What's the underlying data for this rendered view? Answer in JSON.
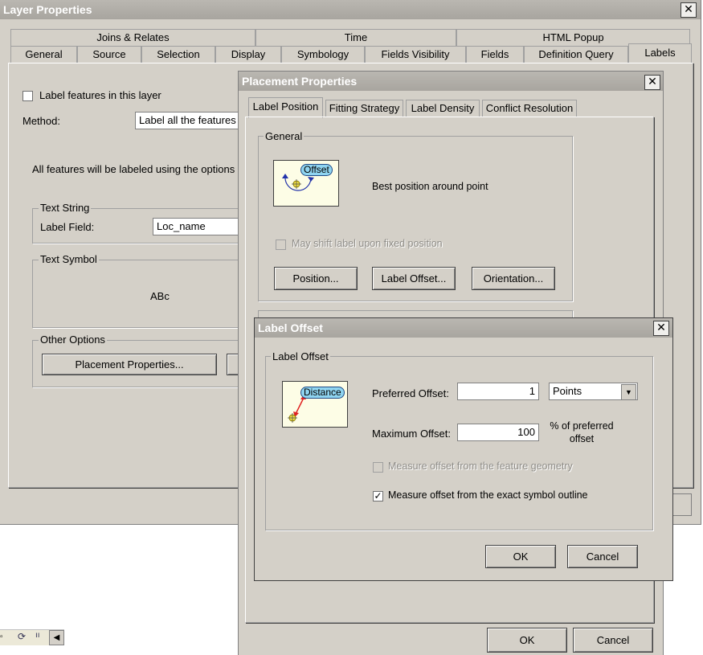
{
  "layer_props": {
    "title": "Layer Properties",
    "tabs_row1": [
      "Joins & Relates",
      "Time",
      "HTML Popup"
    ],
    "tabs_row2": [
      "General",
      "Source",
      "Selection",
      "Display",
      "Symbology",
      "Fields Visibility",
      "Fields",
      "Definition Query",
      "Labels"
    ],
    "label_features": "Label features in this layer",
    "method_label": "Method:",
    "method_value": "Label all the features",
    "info_text": "All features will be labeled using the options",
    "text_string_group": "Text String",
    "label_field_label": "Label Field:",
    "label_field_value": "Loc_name",
    "text_symbol_group": "Text Symbol",
    "symbol_preview": "ABc",
    "other_options_group": "Other Options",
    "placement_props_button": "Placement Properties..."
  },
  "placement_props": {
    "title": "Placement Properties",
    "tabs": [
      "Label Position",
      "Fitting Strategy",
      "Label Density",
      "Conflict Resolution"
    ],
    "general_group": "General",
    "offset_graphic_label": "Offset",
    "best_position": "Best position around point",
    "may_shift": "May shift label upon fixed position",
    "position_button": "Position...",
    "label_offset_button": "Label Offset...",
    "orientation_button": "Orientation...",
    "ok": "OK",
    "cancel": "Cancel"
  },
  "label_offset": {
    "title": "Label Offset",
    "group": "Label Offset",
    "distance_graphic_label": "Distance",
    "preferred_label": "Preferred Offset:",
    "preferred_value": "1",
    "units_value": "Points",
    "maximum_label": "Maximum Offset:",
    "maximum_value": "100",
    "percent_text": "% of preferred offset",
    "measure_geometry": "Measure offset from the feature geometry",
    "measure_symbol": "Measure offset from the exact symbol outline",
    "measure_symbol_checked": true,
    "ok": "OK",
    "cancel": "Cancel"
  }
}
